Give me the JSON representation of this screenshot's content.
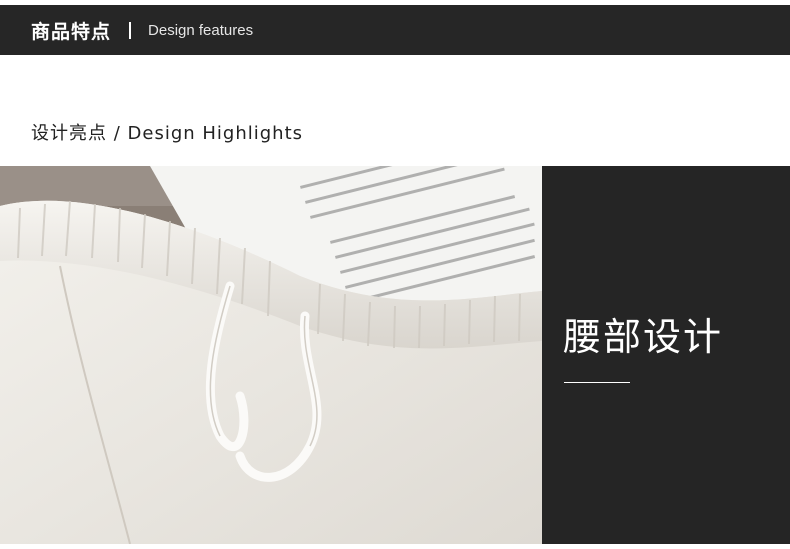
{
  "header": {
    "title_cn": "商品特点",
    "separator": "|",
    "title_en": "Design features"
  },
  "section": {
    "subtitle": "设计亮点 / Design Highlights"
  },
  "feature": {
    "photo": "waistband-photo",
    "title": "腰部设计"
  },
  "colors": {
    "dark_bar": "#262626",
    "panel": "#252525",
    "text_dark": "#222222",
    "text_light": "#ffffff"
  }
}
